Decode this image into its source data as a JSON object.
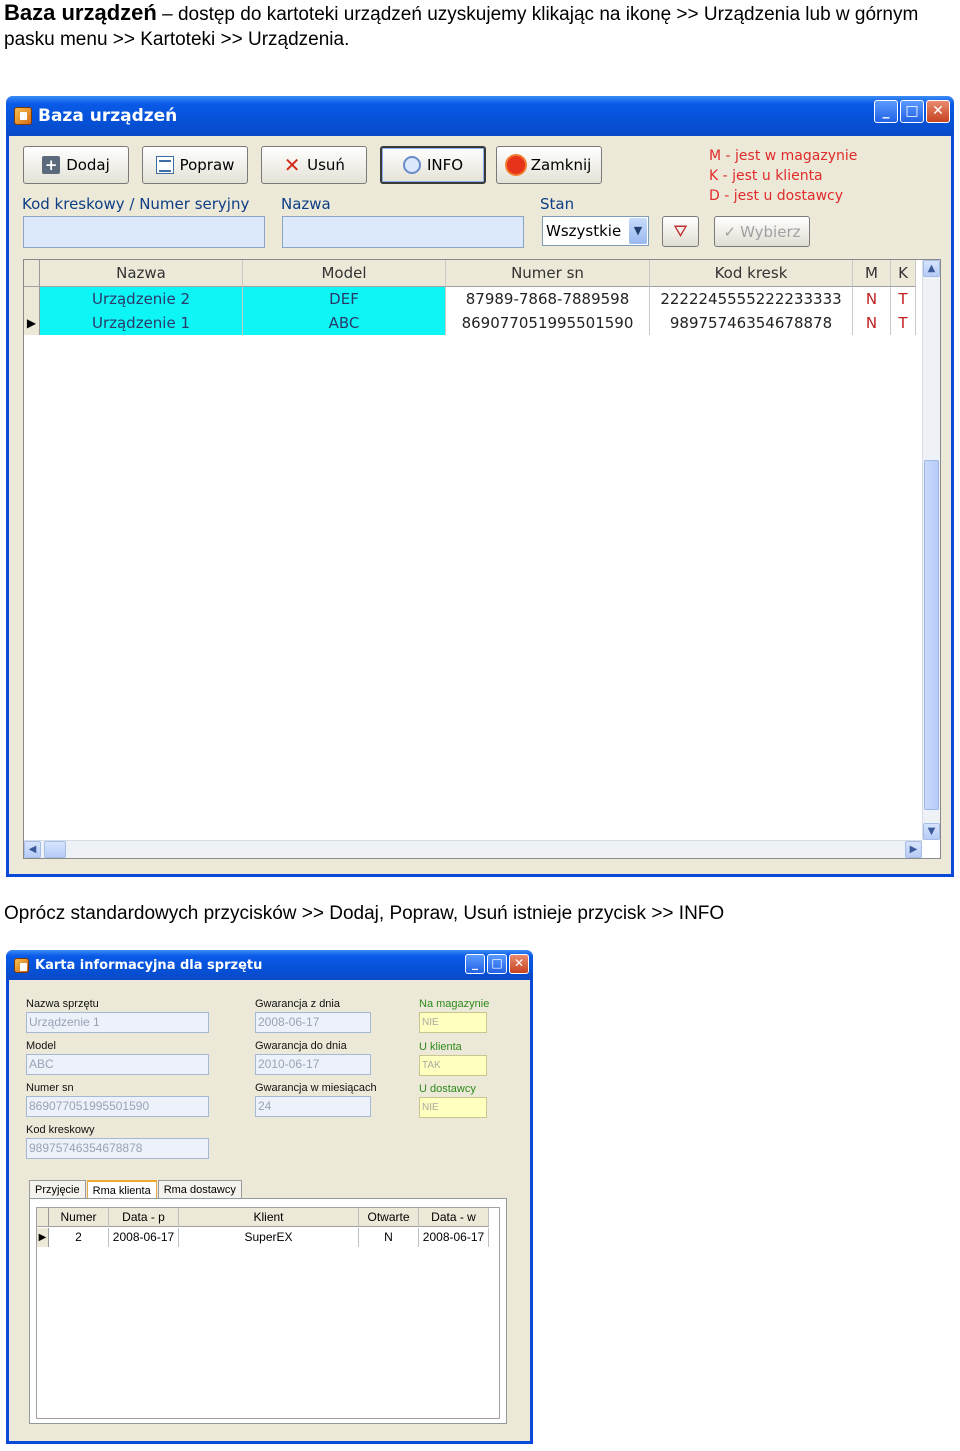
{
  "intro": {
    "bold": "Baza urządzeń",
    "text": " – dostęp do kartoteki urządzeń uzyskujemy klikając na ikonę >> Urządzenia lub w górnym pasku menu >> Kartoteki >> Urządzenia."
  },
  "between_text": "Oprócz standardowych przycisków >> Dodaj, Popraw, Usuń istnieje przycisk >> INFO",
  "window1": {
    "title": "Baza urządzeń",
    "toolbar": {
      "add": "Dodaj",
      "edit": "Popraw",
      "delete": "Usuń",
      "info": "INFO",
      "close": "Zamknij"
    },
    "legend": [
      "M - jest w magazynie",
      "K - jest u klienta",
      "D - jest u dostawcy"
    ],
    "labels": {
      "barcode": "Kod kreskowy / Numer seryjny",
      "name": "Nazwa",
      "state": "Stan"
    },
    "state_value": "Wszystkie",
    "select_button": "Wybierz",
    "grid": {
      "columns": [
        "Nazwa",
        "Model",
        "Numer sn",
        "Kod kresk",
        "M",
        "K"
      ],
      "rows": [
        {
          "name": "Urządzenie 2",
          "model": "DEF",
          "sn": "87989-7868-7889598",
          "kod": "2222245555222233333",
          "m": "N",
          "k": "T"
        },
        {
          "name": "Urządzenie 1",
          "model": "ABC",
          "sn": "869077051995501590",
          "kod": "98975746354678878",
          "m": "N",
          "k": "T"
        }
      ]
    }
  },
  "window2": {
    "title": "Karta informacyjna dla sprzętu",
    "fields": {
      "name_label": "Nazwa sprzętu",
      "name_value": "Urządzenie 1",
      "model_label": "Model",
      "model_value": "ABC",
      "sn_label": "Numer sn",
      "sn_value": "869077051995501590",
      "kod_label": "Kod kreskowy",
      "kod_value": "98975746354678878",
      "wfrom_label": "Gwarancja z dnia",
      "wfrom_value": "2008-06-17",
      "wto_label": "Gwarancja do dnia",
      "wto_value": "2010-06-17",
      "wmonths_label": "Gwarancja w miesiącach",
      "wmonths_value": "24",
      "mag_label": "Na magazynie",
      "mag_value": "NIE",
      "kli_label": "U klienta",
      "kli_value": "TAK",
      "dost_label": "U dostawcy",
      "dost_value": "NIE"
    },
    "tabs": [
      "Przyjęcie",
      "Rma klienta",
      "Rma dostawcy"
    ],
    "grid": {
      "columns": [
        "Numer",
        "Data - p",
        "Klient",
        "Otwarte",
        "Data - w"
      ],
      "rows": [
        {
          "numer": "2",
          "data_p": "2008-06-17",
          "klient": "SuperEX",
          "otwarte": "N",
          "data_w": "2008-06-17"
        }
      ]
    }
  },
  "colors": {
    "title_bar": "#0552d8",
    "row_highlight": "#0df5f5",
    "legend_red": "#e12b2b",
    "label_green": "#2d8a1a"
  }
}
